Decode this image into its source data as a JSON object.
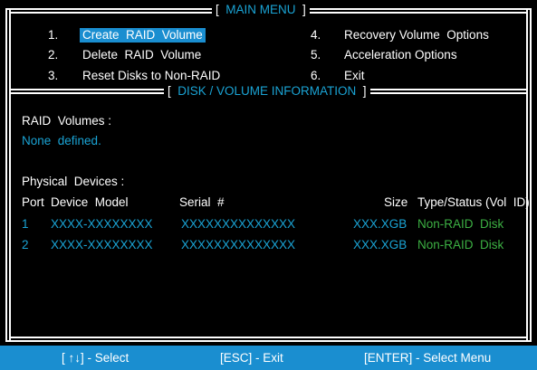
{
  "main_menu": {
    "title": "MAIN MENU",
    "items": [
      {
        "num": "1.",
        "label": "Create  RAID  Volume",
        "selected": true
      },
      {
        "num": "2.",
        "label": "Delete  RAID  Volume"
      },
      {
        "num": "3.",
        "label": "Reset Disks to Non-RAID"
      },
      {
        "num": "4.",
        "label": "Recovery Volume  Options"
      },
      {
        "num": "5.",
        "label": "Acceleration Options"
      },
      {
        "num": "6.",
        "label": "Exit"
      }
    ]
  },
  "info": {
    "title": "DISK / VOLUME INFORMATION",
    "raid_volumes_label": "RAID  Volumes :",
    "raid_volumes_value": "None  defined.",
    "physical_devices_label": "Physical  Devices :",
    "columns": {
      "port": "Port",
      "model": "Device  Model",
      "serial": "Serial  #",
      "size": "Size",
      "type": "Type/Status (Vol  ID)"
    },
    "devices": [
      {
        "port": "1",
        "model": "XXXX-XXXXXXXX",
        "serial": "XXXXXXXXXXXXXX",
        "size": "XXX.XGB",
        "type": "Non-RAID  Disk"
      },
      {
        "port": "2",
        "model": "XXXX-XXXXXXXX",
        "serial": "XXXXXXXXXXXXXX",
        "size": "XXX.XGB",
        "type": "Non-RAID  Disk"
      }
    ]
  },
  "status_bar": {
    "select": "[ ↑↓] - Select",
    "exit": "[ESC] - Exit",
    "enter": "[ENTER] - Select Menu"
  },
  "colors": {
    "accent_blue": "#1aa3d4",
    "highlight": "#1a8ed0",
    "green": "#3cb043"
  }
}
